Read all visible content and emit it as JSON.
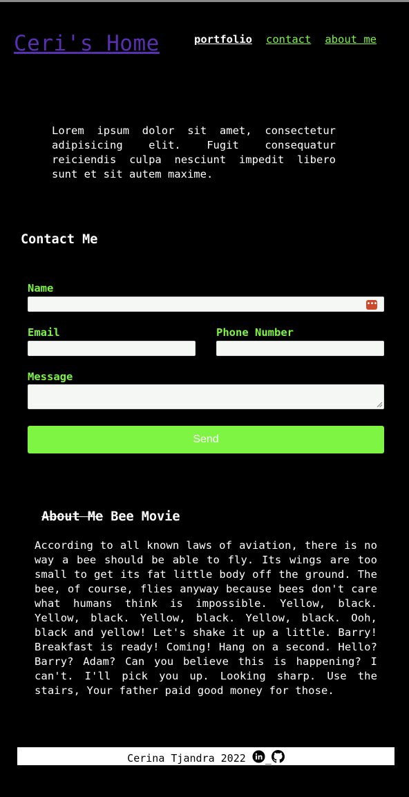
{
  "header": {
    "site_title": "Ceri's Home",
    "nav": [
      {
        "label": "portfolio",
        "active": true
      },
      {
        "label": "contact",
        "active": false
      },
      {
        "label": "about me",
        "active": false
      }
    ]
  },
  "intro": {
    "text": "Lorem ipsum dolor sit amet, consectetur adipisicing elit. Fugit consequatur reiciendis culpa nesciunt impedit libero sunt et sit autem maxime."
  },
  "contact": {
    "heading": "Contact Me",
    "name_label": "Name",
    "email_label": "Email",
    "phone_label": "Phone Number",
    "message_label": "Message",
    "send_label": "Send"
  },
  "about": {
    "heading_struck": "About Me",
    "heading_rest": " Bee Movie",
    "text": "According to all known laws of aviation, there is no way a bee should be able to fly. Its wings are too small to get its fat little body off the ground. The bee, of course, flies anyway because bees don't care what humans think is impossible. Yellow, black. Yellow, black. Yellow, black. Yellow, black. Ooh, black and yellow! Let's shake it up a little. Barry! Breakfast is ready! Coming! Hang on a second. Hello? Barry? Adam? Can you believe this is happening? I can't. I'll pick you up. Looking sharp. Use the stairs, Your father paid good money for those."
  },
  "footer": {
    "text": "Cerina Tjandra 2022",
    "separator": "_",
    "icons": [
      "linkedin-icon",
      "github-icon"
    ]
  },
  "colors": {
    "accent_green": "#7ef542",
    "title_purple": "#5b2fb1",
    "background": "#000000",
    "autofill_icon": "#cc4a2e"
  }
}
